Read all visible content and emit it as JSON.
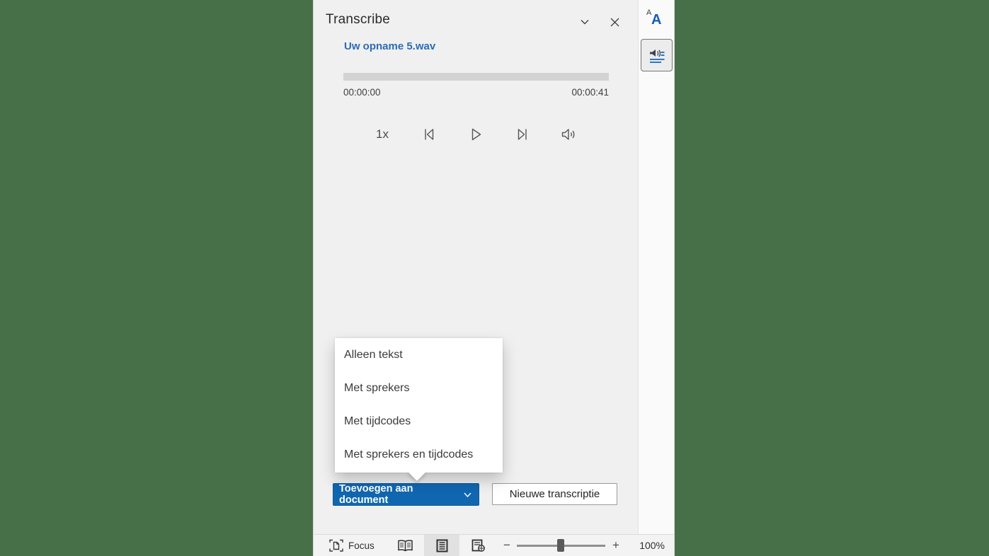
{
  "pane": {
    "header": {
      "title": "Transcribe"
    },
    "file_link": {
      "label": "Uw opname 5.wav"
    },
    "player": {
      "elapsed": "00:00:00",
      "duration": "00:00:41",
      "speed_label": "1x",
      "progress_percent": 0
    },
    "menu": {
      "items": [
        "Alleen tekst",
        "Met sprekers",
        "Met tijdcodes",
        "Met sprekers en tijdcodes"
      ]
    },
    "actions": {
      "add_to_document_label": "Toevoegen aan document",
      "new_transcription_label": "Nieuwe transcriptie"
    }
  },
  "sidebar": {
    "text_tab_glyph_small": "A",
    "text_tab_glyph_large": "A"
  },
  "status_bar": {
    "focus_label": "Focus",
    "zoom_level": "100%",
    "zoom_minus_glyph": "−",
    "zoom_plus_glyph": "+"
  },
  "colors": {
    "desktop_background": "#477049",
    "pane_background": "#f0f0f0",
    "primary_button_blue": "#1067b0",
    "link_blue": "#2b6cb5",
    "tab_icon_blue": "#185abd",
    "transcribe_line_blue": "#2e77c0"
  }
}
